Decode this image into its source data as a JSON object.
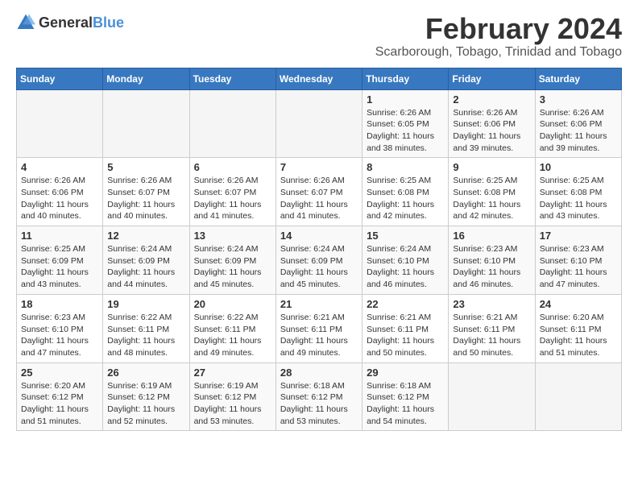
{
  "header": {
    "logo_general": "General",
    "logo_blue": "Blue",
    "title": "February 2024",
    "subtitle": "Scarborough, Tobago, Trinidad and Tobago"
  },
  "calendar": {
    "days_of_week": [
      "Sunday",
      "Monday",
      "Tuesday",
      "Wednesday",
      "Thursday",
      "Friday",
      "Saturday"
    ],
    "weeks": [
      {
        "days": [
          {
            "number": "",
            "info": "",
            "empty": true
          },
          {
            "number": "",
            "info": "",
            "empty": true
          },
          {
            "number": "",
            "info": "",
            "empty": true
          },
          {
            "number": "",
            "info": "",
            "empty": true
          },
          {
            "number": "1",
            "info": "Sunrise: 6:26 AM\nSunset: 6:05 PM\nDaylight: 11 hours\nand 38 minutes.",
            "empty": false
          },
          {
            "number": "2",
            "info": "Sunrise: 6:26 AM\nSunset: 6:06 PM\nDaylight: 11 hours\nand 39 minutes.",
            "empty": false
          },
          {
            "number": "3",
            "info": "Sunrise: 6:26 AM\nSunset: 6:06 PM\nDaylight: 11 hours\nand 39 minutes.",
            "empty": false
          }
        ]
      },
      {
        "days": [
          {
            "number": "4",
            "info": "Sunrise: 6:26 AM\nSunset: 6:06 PM\nDaylight: 11 hours\nand 40 minutes.",
            "empty": false
          },
          {
            "number": "5",
            "info": "Sunrise: 6:26 AM\nSunset: 6:07 PM\nDaylight: 11 hours\nand 40 minutes.",
            "empty": false
          },
          {
            "number": "6",
            "info": "Sunrise: 6:26 AM\nSunset: 6:07 PM\nDaylight: 11 hours\nand 41 minutes.",
            "empty": false
          },
          {
            "number": "7",
            "info": "Sunrise: 6:26 AM\nSunset: 6:07 PM\nDaylight: 11 hours\nand 41 minutes.",
            "empty": false
          },
          {
            "number": "8",
            "info": "Sunrise: 6:25 AM\nSunset: 6:08 PM\nDaylight: 11 hours\nand 42 minutes.",
            "empty": false
          },
          {
            "number": "9",
            "info": "Sunrise: 6:25 AM\nSunset: 6:08 PM\nDaylight: 11 hours\nand 42 minutes.",
            "empty": false
          },
          {
            "number": "10",
            "info": "Sunrise: 6:25 AM\nSunset: 6:08 PM\nDaylight: 11 hours\nand 43 minutes.",
            "empty": false
          }
        ]
      },
      {
        "days": [
          {
            "number": "11",
            "info": "Sunrise: 6:25 AM\nSunset: 6:09 PM\nDaylight: 11 hours\nand 43 minutes.",
            "empty": false
          },
          {
            "number": "12",
            "info": "Sunrise: 6:24 AM\nSunset: 6:09 PM\nDaylight: 11 hours\nand 44 minutes.",
            "empty": false
          },
          {
            "number": "13",
            "info": "Sunrise: 6:24 AM\nSunset: 6:09 PM\nDaylight: 11 hours\nand 45 minutes.",
            "empty": false
          },
          {
            "number": "14",
            "info": "Sunrise: 6:24 AM\nSunset: 6:09 PM\nDaylight: 11 hours\nand 45 minutes.",
            "empty": false
          },
          {
            "number": "15",
            "info": "Sunrise: 6:24 AM\nSunset: 6:10 PM\nDaylight: 11 hours\nand 46 minutes.",
            "empty": false
          },
          {
            "number": "16",
            "info": "Sunrise: 6:23 AM\nSunset: 6:10 PM\nDaylight: 11 hours\nand 46 minutes.",
            "empty": false
          },
          {
            "number": "17",
            "info": "Sunrise: 6:23 AM\nSunset: 6:10 PM\nDaylight: 11 hours\nand 47 minutes.",
            "empty": false
          }
        ]
      },
      {
        "days": [
          {
            "number": "18",
            "info": "Sunrise: 6:23 AM\nSunset: 6:10 PM\nDaylight: 11 hours\nand 47 minutes.",
            "empty": false
          },
          {
            "number": "19",
            "info": "Sunrise: 6:22 AM\nSunset: 6:11 PM\nDaylight: 11 hours\nand 48 minutes.",
            "empty": false
          },
          {
            "number": "20",
            "info": "Sunrise: 6:22 AM\nSunset: 6:11 PM\nDaylight: 11 hours\nand 49 minutes.",
            "empty": false
          },
          {
            "number": "21",
            "info": "Sunrise: 6:21 AM\nSunset: 6:11 PM\nDaylight: 11 hours\nand 49 minutes.",
            "empty": false
          },
          {
            "number": "22",
            "info": "Sunrise: 6:21 AM\nSunset: 6:11 PM\nDaylight: 11 hours\nand 50 minutes.",
            "empty": false
          },
          {
            "number": "23",
            "info": "Sunrise: 6:21 AM\nSunset: 6:11 PM\nDaylight: 11 hours\nand 50 minutes.",
            "empty": false
          },
          {
            "number": "24",
            "info": "Sunrise: 6:20 AM\nSunset: 6:11 PM\nDaylight: 11 hours\nand 51 minutes.",
            "empty": false
          }
        ]
      },
      {
        "days": [
          {
            "number": "25",
            "info": "Sunrise: 6:20 AM\nSunset: 6:12 PM\nDaylight: 11 hours\nand 51 minutes.",
            "empty": false
          },
          {
            "number": "26",
            "info": "Sunrise: 6:19 AM\nSunset: 6:12 PM\nDaylight: 11 hours\nand 52 minutes.",
            "empty": false
          },
          {
            "number": "27",
            "info": "Sunrise: 6:19 AM\nSunset: 6:12 PM\nDaylight: 11 hours\nand 53 minutes.",
            "empty": false
          },
          {
            "number": "28",
            "info": "Sunrise: 6:18 AM\nSunset: 6:12 PM\nDaylight: 11 hours\nand 53 minutes.",
            "empty": false
          },
          {
            "number": "29",
            "info": "Sunrise: 6:18 AM\nSunset: 6:12 PM\nDaylight: 11 hours\nand 54 minutes.",
            "empty": false
          },
          {
            "number": "",
            "info": "",
            "empty": true
          },
          {
            "number": "",
            "info": "",
            "empty": true
          }
        ]
      }
    ]
  }
}
